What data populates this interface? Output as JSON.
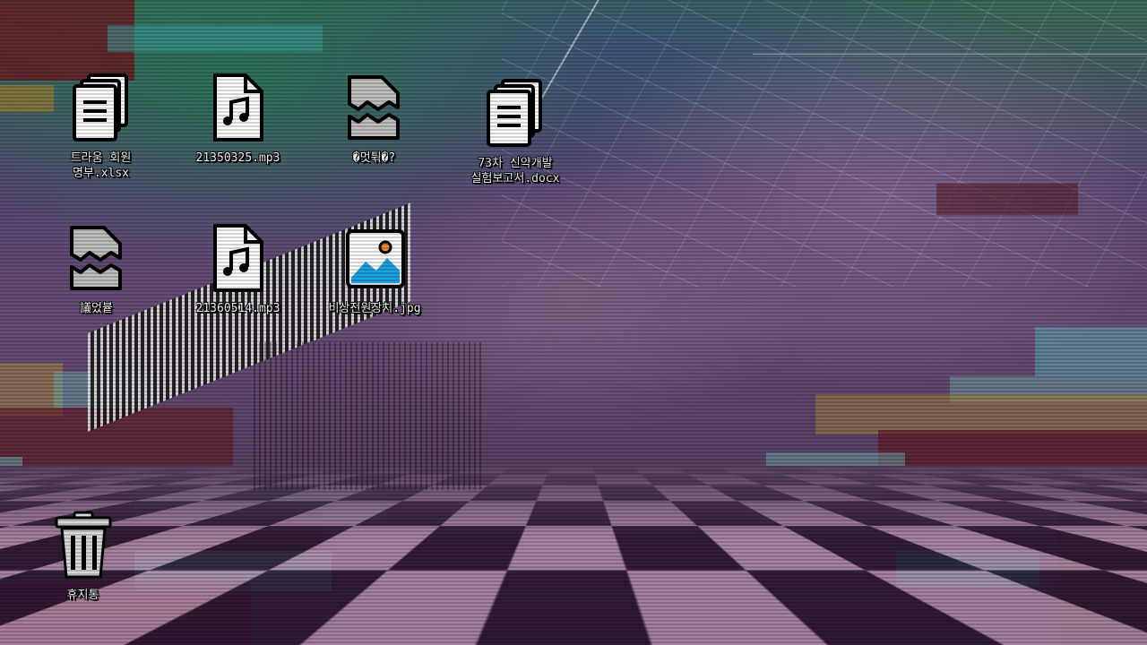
{
  "desktop": {
    "icons": [
      {
        "label": "트라움 회원\n명부.xlsx",
        "type": "document-stack"
      },
      {
        "label": "21350325.mp3",
        "type": "audio-file"
      },
      {
        "label": "�멋튂�?",
        "type": "corrupted-file"
      },
      {
        "label": "73차 신약개발\n실험보고서.docx",
        "type": "document-stack"
      },
      {
        "label": "議었븉",
        "type": "corrupted-file"
      },
      {
        "label": "21360514.mp3",
        "type": "audio-file"
      },
      {
        "label": "비상전원장치.jpg",
        "type": "image-file"
      }
    ],
    "recycle_bin": {
      "label": "휴지통",
      "type": "trash-bin"
    }
  },
  "colors": {
    "accent_blue": "#1aa3e0",
    "accent_orange": "#f08a2c",
    "icon_white": "#ffffff",
    "icon_outline": "#000000"
  }
}
